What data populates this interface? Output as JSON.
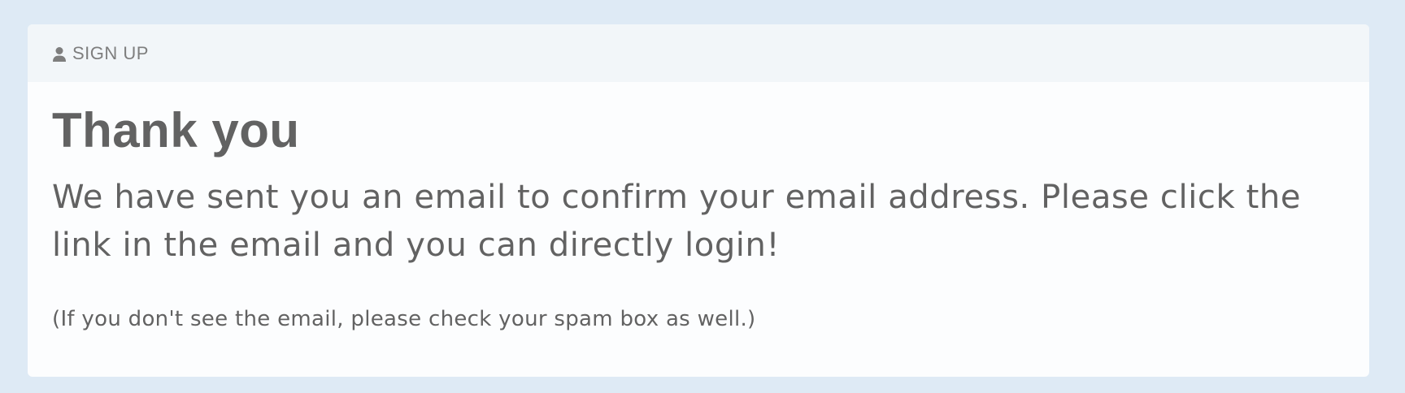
{
  "header": {
    "icon": "user-icon",
    "label": "SIGN UP"
  },
  "content": {
    "title": "Thank you",
    "message": "We have sent you an email to confirm your email address. Please click the link in the email and you can directly login!",
    "note": "(If you don't see the email, please check your spam box as well.)"
  },
  "colors": {
    "page_background": "#deeaf5",
    "card_background": "#fcfdfe",
    "header_background": "#f2f6f9",
    "text": "#626262",
    "header_text": "#7e7e7e"
  }
}
